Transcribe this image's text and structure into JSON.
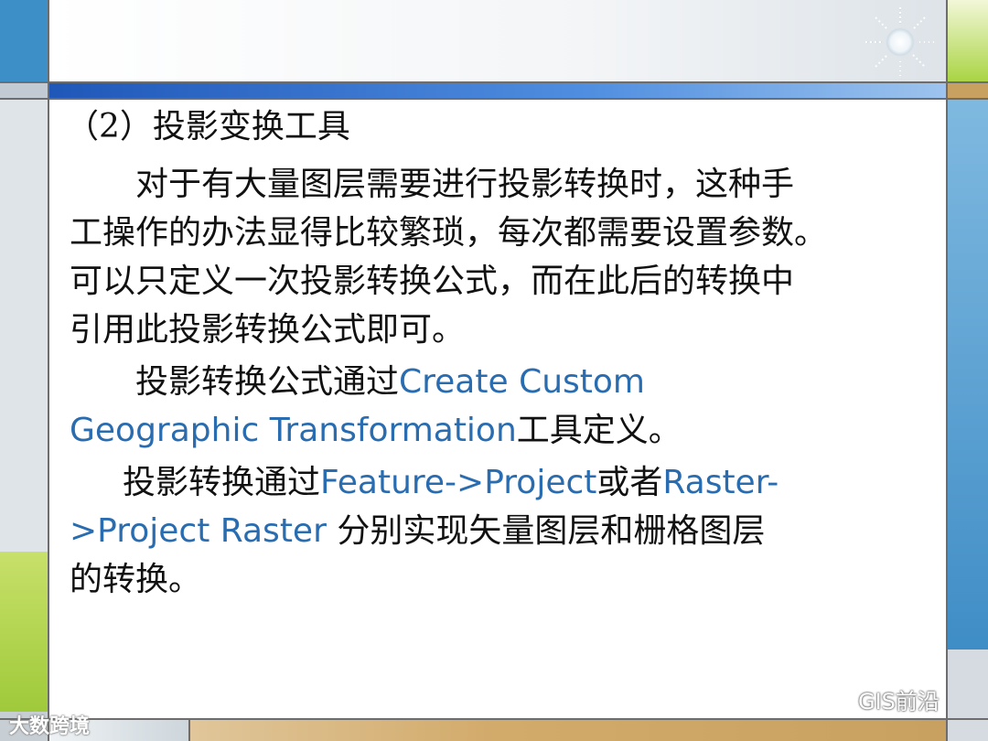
{
  "slide": {
    "heading": "（2）投影变换工具",
    "para1": {
      "lines": [
        "对于有大量图层需要进行投影转换时，这种手",
        "工操作的办法显得比较繁琐，每次都需要设置参数。",
        "可以只定义一次投影转换公式，而在此后的转换中",
        "引用此投影转换公式即可。"
      ]
    },
    "para2": {
      "lead": "投影转换公式通过",
      "term1": "Create Custom",
      "term2": "Geographic Transformation",
      "tail": "工具定义。"
    },
    "para3": {
      "lead": "投影转换通过",
      "term1": "Feature->Project",
      "mid": "或者",
      "term2": "Raster-",
      "term3": ">Project Raster",
      "tail1": " 分别实现矢量图层和栅格图层",
      "tail2": "的转换。"
    }
  },
  "watermarks": {
    "left": "大数跨境",
    "right": "GIS前沿"
  },
  "colors": {
    "accent_blue": "#2a6cb0",
    "green": "#9fca3a",
    "band_blue": "#1f57b8"
  }
}
